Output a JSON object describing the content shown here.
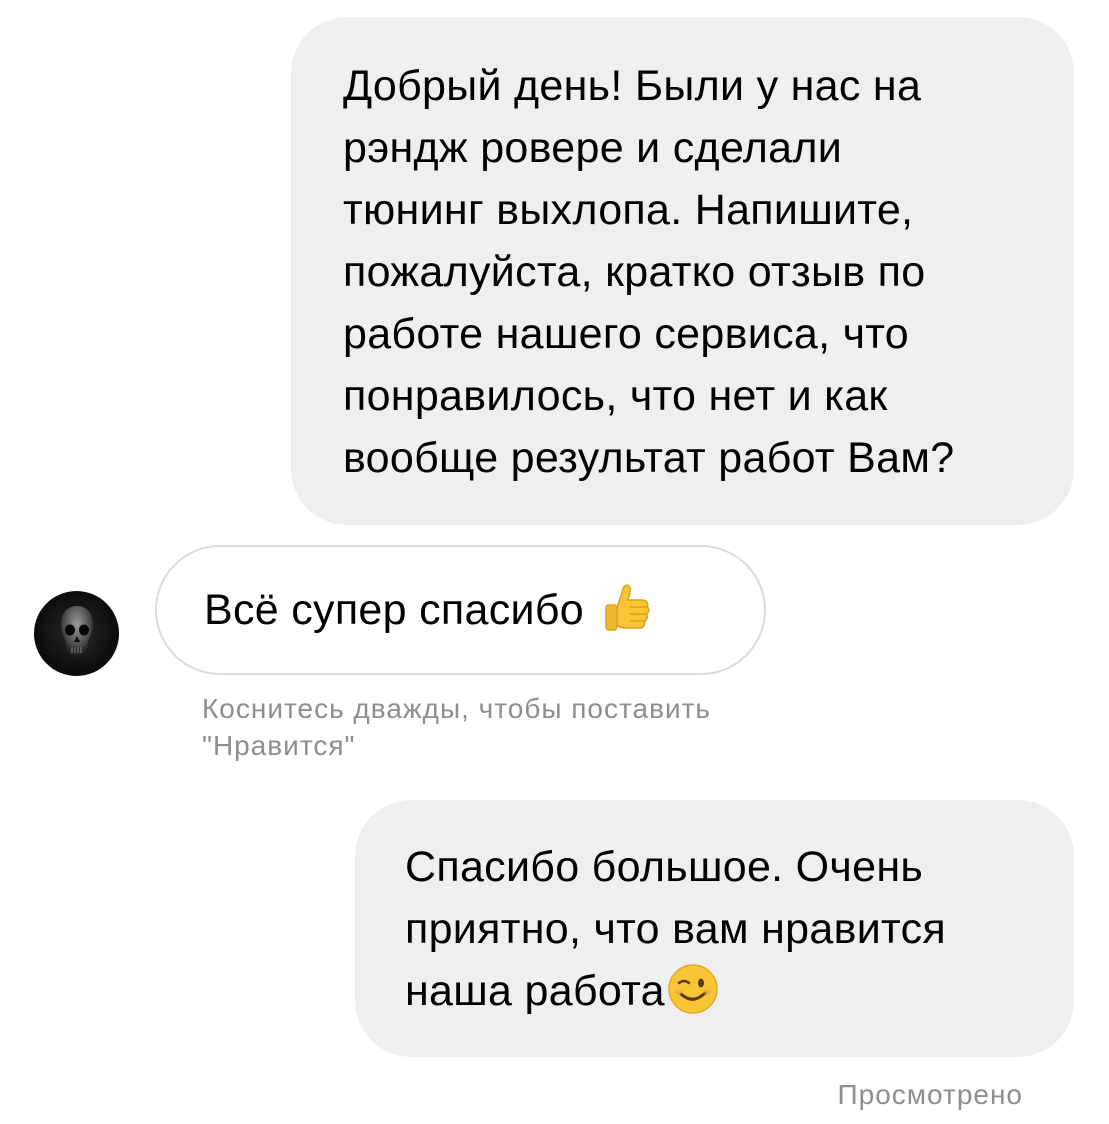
{
  "conversation": {
    "message_1": {
      "text": "Добрый день! Были у нас на\nрэндж ровере и сделали\nтюнинг выхлопа. Напишите,\nпожалуйста, кратко отзыв по\nработе нашего сервиса, что\nпонравилось, что нет и как\nвообще результат работ Вам?"
    },
    "message_2": {
      "text": "Всё супер спасибо",
      "emoji": "thumbs-up-icon",
      "avatar_icon": "skull-icon"
    },
    "like_hint": "Коснитесь дважды, чтобы поставить\n\"Нравится\"",
    "message_3": {
      "text": "Спасибо большое. Очень\nприятно, что вам нравится\nнаша работа",
      "emoji": "winking-face-icon"
    },
    "seen_status": "Просмотрено"
  },
  "colors": {
    "outgoing_bubble": "#efefef",
    "incoming_border": "#dbdbdb",
    "meta_text": "#8e8e8e",
    "emoji_yellow": "#f7c536"
  }
}
